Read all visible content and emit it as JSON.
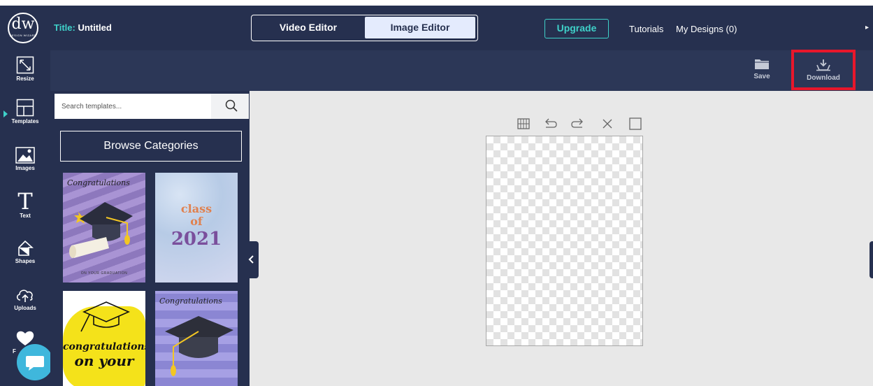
{
  "header": {
    "logo_text": "dw",
    "logo_subtext": "DESIGN WIZARD",
    "title_label": "Title:",
    "title_value": "Untitled",
    "mode_tabs": [
      {
        "label": "Video Editor",
        "selected": false
      },
      {
        "label": "Image Editor",
        "selected": true
      }
    ],
    "upgrade_label": "Upgrade",
    "tutorials_label": "Tutorials",
    "my_designs_label": "My Designs (0)"
  },
  "toolbar": {
    "save_label": "Save",
    "download_label": "Download",
    "download_highlight_color": "#e8172b"
  },
  "sidebar": {
    "items": [
      {
        "label": "Resize",
        "icon": "resize-icon"
      },
      {
        "label": "Templates",
        "icon": "templates-icon",
        "active": true
      },
      {
        "label": "Images",
        "icon": "images-icon"
      },
      {
        "label": "Text",
        "icon": "text-icon"
      },
      {
        "label": "Shapes",
        "icon": "shapes-icon"
      },
      {
        "label": "Uploads",
        "icon": "uploads-icon"
      },
      {
        "label": "F",
        "icon": "heart-icon"
      }
    ]
  },
  "templates_panel": {
    "search_placeholder": "Search templates...",
    "browse_label": "Browse Categories",
    "thumbnails": [
      {
        "script": "Congratulations",
        "footer": "ON YOUR GRADUATION"
      },
      {
        "line1": "class",
        "line2": "of",
        "line3": "2021"
      },
      {
        "line1": "congratulations",
        "line2": "on your"
      },
      {
        "script": "Congratulations"
      }
    ]
  },
  "canvas_tools": [
    "grid-icon",
    "undo-icon",
    "redo-icon",
    "close-icon",
    "square-icon"
  ],
  "colors": {
    "navy": "#26304f",
    "teal": "#3fd1c9",
    "canvas_bg": "#e8e8e8"
  }
}
